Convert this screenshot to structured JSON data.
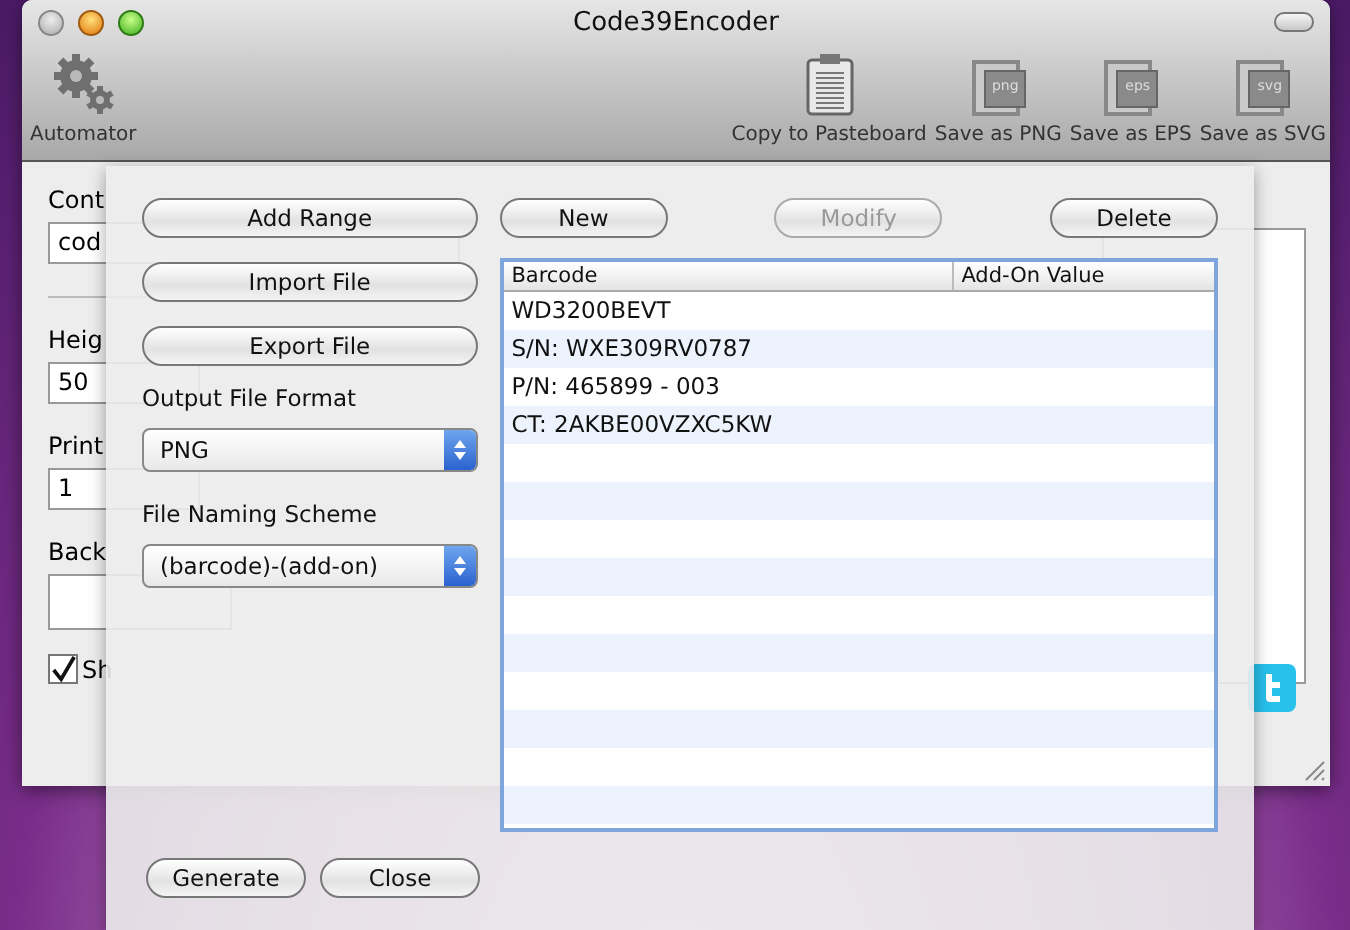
{
  "window": {
    "title": "Code39Encoder"
  },
  "toolbar": {
    "left": [
      {
        "label": "Automator",
        "kind": "gear"
      }
    ],
    "right": [
      {
        "label": "Copy to Pasteboard",
        "kind": "clipboard"
      },
      {
        "label": "Save as PNG",
        "kind": "doc",
        "icon_text": "png"
      },
      {
        "label": "Save as EPS",
        "kind": "doc",
        "icon_text": "eps"
      },
      {
        "label": "Save as SVG",
        "kind": "doc",
        "icon_text": "svg"
      }
    ]
  },
  "background_form": {
    "content_label": "Cont",
    "content_value": "cod",
    "height_label": "Heig",
    "height_value": "50",
    "print_label": "Print",
    "print_value": "1",
    "background_label": "Back",
    "checkbox": {
      "label": "Sh",
      "checked": true
    }
  },
  "sheet": {
    "left_buttons": [
      "Add Range",
      "Import File",
      "Export File"
    ],
    "output_format": {
      "label": "Output File Format",
      "value": "PNG"
    },
    "naming_scheme": {
      "label": "File Naming Scheme",
      "value": "(barcode)-(add-on)"
    },
    "top_buttons": [
      {
        "label": "New",
        "disabled": false
      },
      {
        "label": "Modify",
        "disabled": true
      },
      {
        "label": "Delete",
        "disabled": false
      }
    ],
    "table": {
      "columns": [
        "Barcode",
        "Add-On Value"
      ],
      "rows": [
        [
          "WD3200BEVT",
          ""
        ],
        [
          "S/N: WXE309RV0787",
          ""
        ],
        [
          "P/N: 465899 - 003",
          ""
        ],
        [
          "CT: 2AKBE00VZXC5KW",
          ""
        ]
      ]
    },
    "bottom_buttons": [
      "Generate",
      "Close"
    ]
  }
}
